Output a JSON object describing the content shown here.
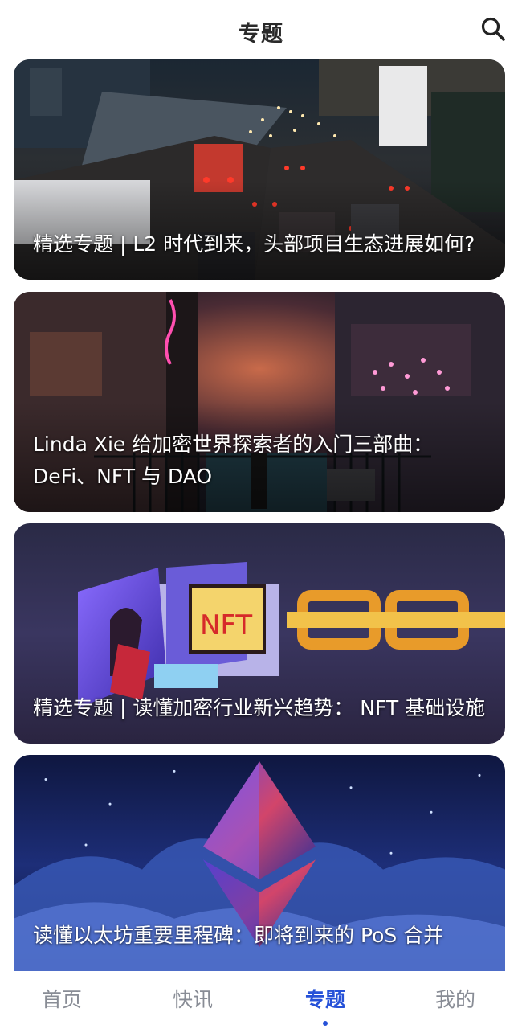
{
  "header": {
    "title": "专题",
    "search_icon": "search-icon"
  },
  "cards": [
    {
      "title": "精选专题 | L2 时代到来，头部项目生态进展如何?",
      "image": "city-traffic-night-photo"
    },
    {
      "title": "Linda Xie 给加密世界探索者的入门三部曲：DeFi、NFT 与 DAO",
      "image": "neon-cyberpunk-street-photo"
    },
    {
      "title": "精选专题 | 读懂加密行业新兴趋势： NFT 基础设施",
      "image": "nft-chain-illustration"
    },
    {
      "title": "读懂以太坊重要里程碑：即将到来的 PoS 合并",
      "image": "ethereum-crystal-illustration"
    }
  ],
  "tabbar": {
    "items": [
      {
        "label": "首页",
        "active": false
      },
      {
        "label": "快讯",
        "active": false
      },
      {
        "label": "专题",
        "active": true
      },
      {
        "label": "我的",
        "active": false
      }
    ],
    "active_color": "#2651d8",
    "inactive_color": "#888c95"
  }
}
